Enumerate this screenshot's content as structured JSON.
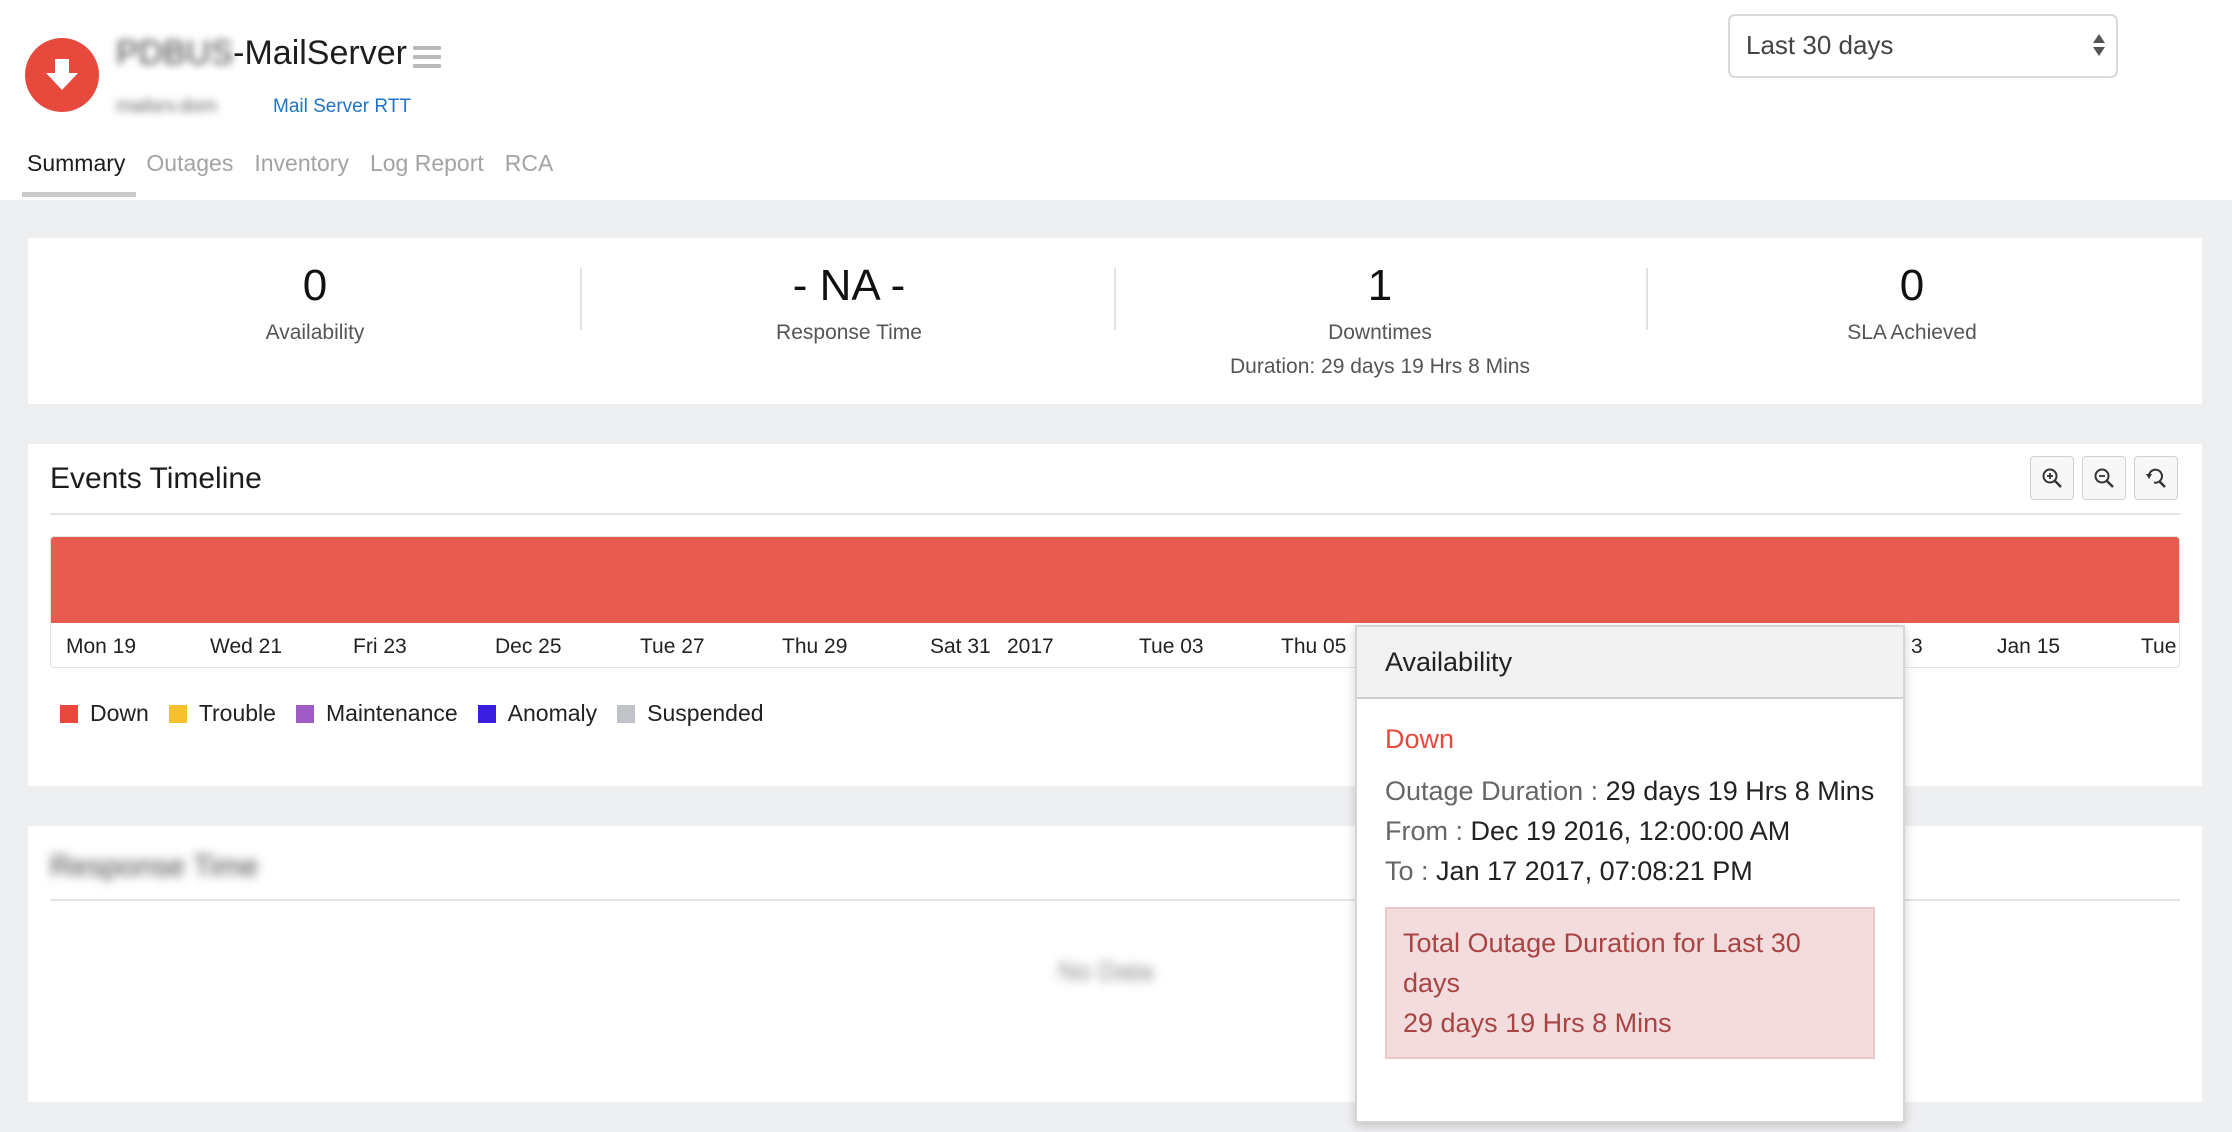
{
  "monitor": {
    "title_blurred": "PDBUS",
    "title_main": "-MailServer",
    "host_blurred": "mailsrv.dom",
    "type_label": "Mail Server RTT"
  },
  "tabs": [
    {
      "label": "Summary",
      "active": true
    },
    {
      "label": "Outages",
      "active": false
    },
    {
      "label": "Inventory",
      "active": false
    },
    {
      "label": "Log Report",
      "active": false
    },
    {
      "label": "RCA",
      "active": false
    }
  ],
  "period_select": {
    "value": "Last 30 days"
  },
  "stats": [
    {
      "value": "0",
      "label": "Availability",
      "sub": ""
    },
    {
      "value": "- NA -",
      "label": "Response Time",
      "sub": ""
    },
    {
      "value": "1",
      "label": "Downtimes",
      "sub": "Duration: 29 days 19 Hrs 8 Mins"
    },
    {
      "value": "0",
      "label": "SLA Achieved",
      "sub": ""
    }
  ],
  "events_timeline": {
    "title": "Events Timeline",
    "zoom_in_icon": "zoom-in-icon",
    "zoom_out_icon": "zoom-out-icon",
    "reset_icon": "zoom-reset-icon",
    "ticks": [
      "Mon 19",
      "Wed 21",
      "Fri 23",
      "Dec 25",
      "Tue 27",
      "Thu 29",
      "Sat 31",
      "2017",
      "Tue 03",
      "Thu 05",
      "3",
      "Jan 15",
      "Tue"
    ],
    "bar_color": "#e85c4f"
  },
  "legend": [
    {
      "label": "Down",
      "color": "#e8493d"
    },
    {
      "label": "Trouble",
      "color": "#f5c02b"
    },
    {
      "label": "Maintenance",
      "color": "#a05cc6"
    },
    {
      "label": "Anomaly",
      "color": "#3a1fe0"
    },
    {
      "label": "Suspended",
      "color": "#c0c3c8"
    }
  ],
  "response_time": {
    "title_blurred": "Response Time",
    "no_data_blurred": "No Data"
  },
  "tooltip": {
    "header": "Availability",
    "status": "Down",
    "duration_key": "Outage Duration :",
    "duration_value": "29 days 19 Hrs 8 Mins",
    "from_key": "From :",
    "from_value": "Dec 19 2016, 12:00:00 AM",
    "to_key": "To :",
    "to_value": "Jan 17 2017, 07:08:21 PM",
    "total_label": "Total Outage Duration for Last 30 days",
    "total_value": "29 days 19 Hrs 8 Mins"
  }
}
